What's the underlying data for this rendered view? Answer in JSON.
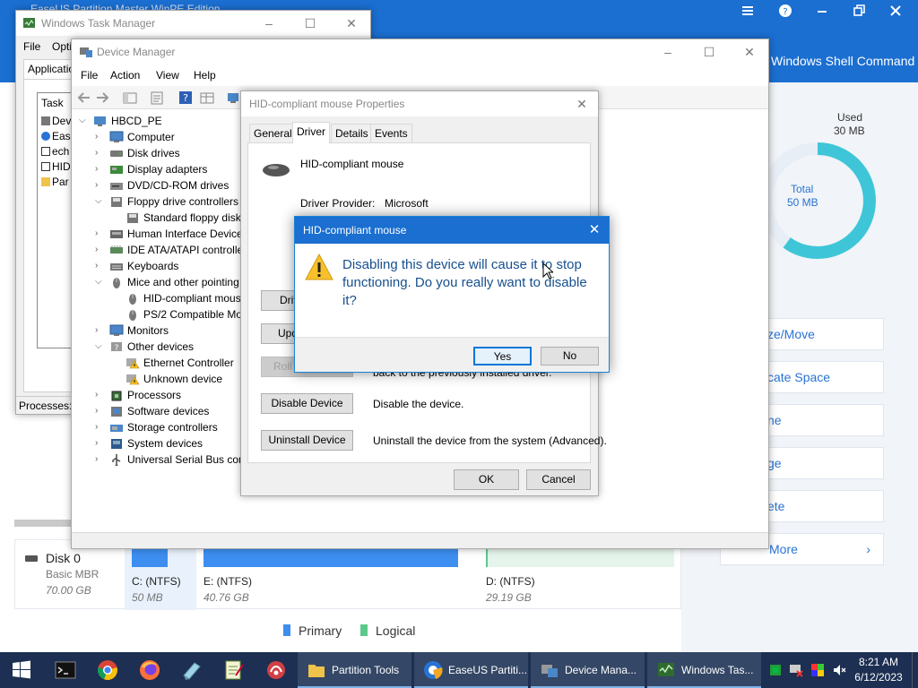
{
  "easeus": {
    "window_title": "EaseUS Partition Master WinPE Edition",
    "banner_text": "Windows Shell Command",
    "used_label": "Used",
    "used_value": "30 MB",
    "total_label": "Total",
    "total_value": "50 MB",
    "used_fraction": 0.6,
    "actions": [
      "ze/Move",
      "cate Space",
      "ne",
      "ge",
      "ete",
      "More"
    ],
    "disk": {
      "name": "Disk 0",
      "type": "Basic MBR",
      "size": "70.00 GB"
    },
    "partitions": [
      {
        "label": "C:  (NTFS)",
        "size": "50 MB"
      },
      {
        "label": "E:  (NTFS)",
        "size": "40.76 GB"
      },
      {
        "label": "D:  (NTFS)",
        "size": "29.19 GB"
      }
    ],
    "legend": {
      "primary": "Primary",
      "logical": "Logical"
    },
    "colors": {
      "brand": "#1b6fd1",
      "primary": "#3d8ef0",
      "logical": "#5cc98a"
    }
  },
  "task_manager": {
    "title": "Windows Task Manager",
    "menu": [
      "File",
      "Opti"
    ],
    "tab": "Applicatio",
    "list_header": "Task",
    "list_items": [
      "Dev",
      "Eas",
      "ech",
      "HID",
      "Par"
    ],
    "status": "Processes: 3"
  },
  "device_manager": {
    "title": "Device Manager",
    "menu": [
      "File",
      "Action",
      "View",
      "Help"
    ],
    "tree": [
      {
        "label": "HBCD_PE",
        "arrow": "▾",
        "icon": "computer-icon"
      },
      {
        "label": "Computer",
        "arrow": "›",
        "icon": "monitor-icon"
      },
      {
        "label": "Disk drives",
        "arrow": "›",
        "icon": "disk-drive-icon"
      },
      {
        "label": "Display adapters",
        "arrow": "›",
        "icon": "display-adapter-icon"
      },
      {
        "label": "DVD/CD-ROM drives",
        "arrow": "›",
        "icon": "dvd-drive-icon"
      },
      {
        "label": "Floppy drive controllers",
        "arrow": "▾",
        "icon": "floppy-controller-icon"
      },
      {
        "label": "Standard floppy disk controller",
        "arrow": "",
        "icon": "floppy-controller-icon"
      },
      {
        "label": "Human Interface Devices",
        "arrow": "›",
        "icon": "hid-icon"
      },
      {
        "label": "IDE ATA/ATAPI controllers",
        "arrow": "›",
        "icon": "ide-controller-icon"
      },
      {
        "label": "Keyboards",
        "arrow": "›",
        "icon": "keyboard-icon"
      },
      {
        "label": "Mice and other pointing devices",
        "arrow": "▾",
        "icon": "mouse-icon"
      },
      {
        "label": "HID-compliant mouse",
        "arrow": "",
        "icon": "mouse-icon"
      },
      {
        "label": "PS/2 Compatible Mouse",
        "arrow": "",
        "icon": "mouse-icon"
      },
      {
        "label": "Monitors",
        "arrow": "›",
        "icon": "monitor-icon"
      },
      {
        "label": "Other devices",
        "arrow": "▾",
        "icon": "unknown-device-icon"
      },
      {
        "label": "Ethernet Controller",
        "arrow": "",
        "icon": "warning-device-icon"
      },
      {
        "label": "Unknown device",
        "arrow": "",
        "icon": "warning-device-icon"
      },
      {
        "label": "Processors",
        "arrow": "›",
        "icon": "processor-icon"
      },
      {
        "label": "Software devices",
        "arrow": "›",
        "icon": "software-device-icon"
      },
      {
        "label": "Storage controllers",
        "arrow": "›",
        "icon": "storage-controller-icon"
      },
      {
        "label": "System devices",
        "arrow": "›",
        "icon": "system-device-icon"
      },
      {
        "label": "Universal Serial Bus controllers",
        "arrow": "›",
        "icon": "usb-icon"
      }
    ]
  },
  "properties": {
    "title": "HID-compliant mouse Properties",
    "tabs": [
      "General",
      "Driver",
      "Details",
      "Events"
    ],
    "device_name": "HID-compliant mouse",
    "provider_label": "Driver Provider:",
    "provider_value": "Microsoft",
    "btn_driver_details": "Driver Details",
    "btn_update": "Update Driver",
    "btn_rollback": "Roll Back Driver",
    "rollback_desc": "back to the previously installed driver.",
    "btn_disable": "Disable Device",
    "disable_desc": "Disable the device.",
    "btn_uninstall": "Uninstall Device",
    "uninstall_desc": "Uninstall the device from the system (Advanced).",
    "ok": "OK",
    "cancel": "Cancel"
  },
  "confirm": {
    "title": "HID-compliant mouse",
    "message": "Disabling this device will cause it to stop functioning. Do you really want to disable it?",
    "yes": "Yes",
    "no": "No"
  },
  "taskbar": {
    "apps": [
      {
        "label": "Partition Tools",
        "icon": "folder-icon"
      },
      {
        "label": "EaseUS Partiti...",
        "icon": "easeus-icon"
      },
      {
        "label": "Device Mana...",
        "icon": "device-manager-icon"
      },
      {
        "label": "Windows Tas...",
        "icon": "task-manager-icon"
      }
    ],
    "time": "8:21 AM",
    "date": "6/12/2023"
  }
}
